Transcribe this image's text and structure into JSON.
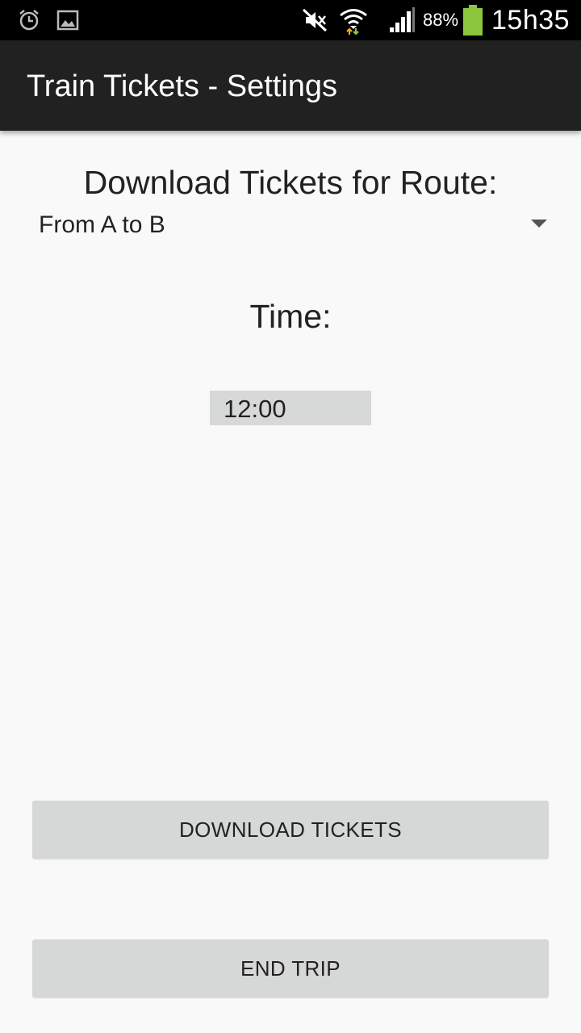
{
  "status_bar": {
    "icons": [
      "alarm-icon",
      "image-icon",
      "mute-icon",
      "wifi-icon",
      "signal-icon",
      "battery-icon"
    ],
    "battery_percent": "88%",
    "time": "15h35",
    "battery_color": "#8cc63f"
  },
  "app_bar": {
    "title": "Train Tickets - Settings",
    "background": "#212121"
  },
  "route": {
    "heading": "Download Tickets for Route:",
    "selected": "From A to B"
  },
  "time": {
    "heading": "Time:",
    "value": "12:00"
  },
  "buttons": {
    "download_label": "DOWNLOAD TICKETS",
    "end_trip_label": "END TRIP"
  }
}
